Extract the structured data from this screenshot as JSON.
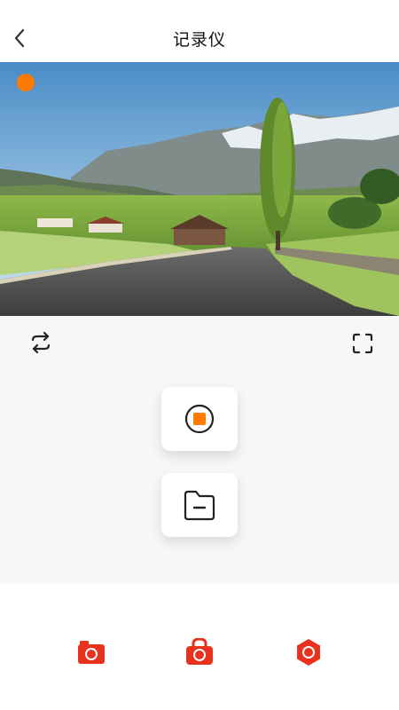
{
  "header": {
    "title": "记录仪",
    "back_icon": "chevron-left-icon"
  },
  "camera": {
    "recording_indicator_color": "#ff7a00"
  },
  "controls": {
    "left_icon": "rotate-camera-icon",
    "right_icon": "fullscreen-icon"
  },
  "actions": {
    "record_icon": "stop-record-icon",
    "files_icon": "folder-icon",
    "accent": "#ff7a00"
  },
  "bottom_nav": {
    "items": [
      {
        "icon": "camera-icon"
      },
      {
        "icon": "locked-camera-icon"
      },
      {
        "icon": "hexagon-camera-icon"
      }
    ],
    "color": "#e8321e"
  }
}
